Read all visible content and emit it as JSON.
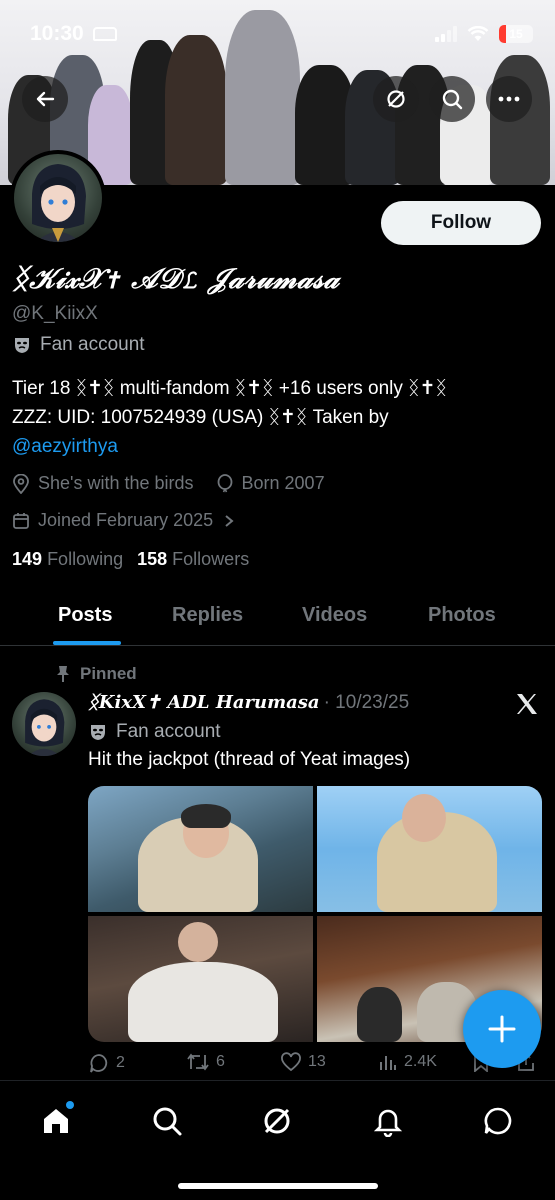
{
  "status_bar": {
    "time": "10:30",
    "battery": "15"
  },
  "header": {
    "back_icon": "arrow-left-icon",
    "grok_icon": "grok-icon",
    "search_icon": "search-icon",
    "more_icon": "more-icon"
  },
  "profile": {
    "follow_label": "Follow",
    "display_name": "ᛝ𝒦𝒾𝓍𝒳✝ 𝒜𝒟ℒ 𝒥𝒶𝓇𝓊𝓂𝒶𝓈𝒶",
    "display_name_plain": "ᛝKixX✝ ADL Harumasa",
    "handle": "@K_KiixX",
    "label": "Fan account",
    "bio_line1": "Tier 18 ᛝ✝ᛝ multi-fandom ᛝ✝ᛝ +16 users only ᛝ✝ᛝ",
    "bio_line2": "ZZZ: UID: 1007524939 (USA) ᛝ✝ᛝ Taken by",
    "bio_mention": "@aezyirthya",
    "location": "She's with the birds",
    "birth": "Born 2007",
    "joined": "Joined February 2025",
    "following_count": "149",
    "following_label": "Following",
    "followers_count": "158",
    "followers_label": "Followers"
  },
  "tabs": [
    "Posts",
    "Replies",
    "Videos",
    "Photos"
  ],
  "active_tab": "Posts",
  "pinned_post": {
    "pinned_label": "Pinned",
    "author": "ᛝKixX✝ ADL Harumasa",
    "date": "· 10/23/25",
    "label": "Fan account",
    "text": "Hit the jackpot (thread of Yeat images)",
    "replies": "2",
    "reposts": "6",
    "likes": "13",
    "views": "2.4K"
  },
  "nav": [
    "home-icon",
    "search-icon",
    "grok-icon",
    "notifications-icon",
    "messages-icon"
  ],
  "colors": {
    "accent": "#1d9bf0",
    "background": "#000000",
    "muted": "#71767b"
  }
}
